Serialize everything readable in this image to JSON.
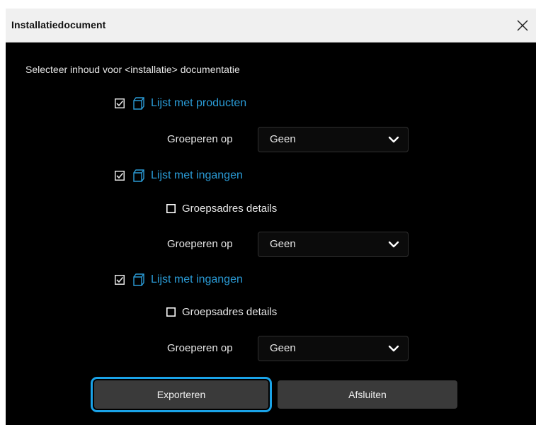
{
  "window": {
    "title": "Installatiedocument",
    "close_icon": "close-icon"
  },
  "prompt": "Selecteer inhoud voor <installatie> documentatie",
  "sections": [
    {
      "checked": true,
      "label": "Lijst met producten",
      "group_label": "Groeperen op",
      "group_value": "Geen"
    },
    {
      "checked": true,
      "label": "Lijst met ingangen",
      "sub_option": {
        "checked": false,
        "label": "Groepsadres details"
      },
      "group_label": "Groeperen op",
      "group_value": "Geen"
    },
    {
      "checked": true,
      "label": "Lijst met ingangen",
      "sub_option": {
        "checked": false,
        "label": "Groepsadres details"
      },
      "group_label": "Groeperen op",
      "group_value": "Geen"
    }
  ],
  "buttons": {
    "export": "Exporteren",
    "close": "Afsluiten"
  },
  "colors": {
    "background": "#000000",
    "titlebar": "#f0f0f0",
    "accent": "#2a9bd6",
    "focus_ring": "#1aa3e8",
    "button": "#3a3a3a"
  }
}
